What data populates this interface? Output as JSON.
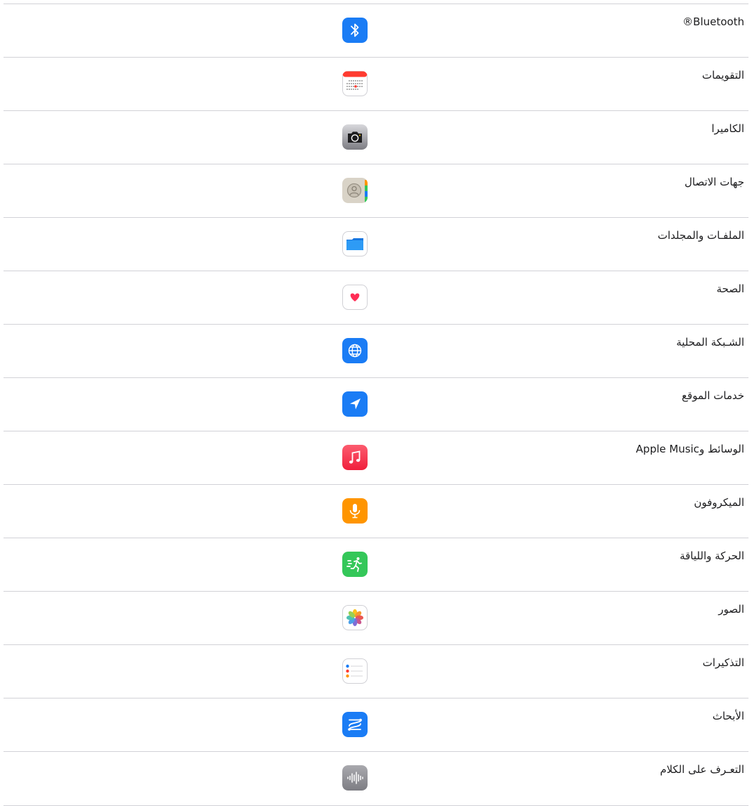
{
  "rows": [
    {
      "label": "Bluetooth®",
      "icon": "bluetooth-icon",
      "color": "#1a7cf5"
    },
    {
      "label": "التقويمات",
      "icon": "calendar-icon",
      "color": "#ff3b30"
    },
    {
      "label": "الكاميرا",
      "icon": "camera-icon",
      "color": "#8e8e93"
    },
    {
      "label": "جهات الاتصال",
      "icon": "contacts-icon",
      "color": "#d9d3c7"
    },
    {
      "label": "الملفـات والمجلدات",
      "icon": "files-icon",
      "color": "#1e8ff0"
    },
    {
      "label": "الصحة",
      "icon": "health-icon",
      "color": "#ff2d55"
    },
    {
      "label": "الشـبكة المحلية",
      "icon": "local-network-icon",
      "color": "#1a7cf5"
    },
    {
      "label": "خدمات الموقع",
      "icon": "location-services-icon",
      "color": "#1a7cf5"
    },
    {
      "label": "الوسائط وApple Music",
      "icon": "music-icon",
      "color": "#fa3c4c"
    },
    {
      "label": "الميكروفون",
      "icon": "microphone-icon",
      "color": "#ff9500"
    },
    {
      "label": "الحركة واللياقة",
      "icon": "motion-fitness-icon",
      "color": "#34c759"
    },
    {
      "label": "الصور",
      "icon": "photos-icon",
      "color": "#ffffff"
    },
    {
      "label": "التذكيرات",
      "icon": "reminders-icon",
      "color": "#ffffff"
    },
    {
      "label": "الأبحاث",
      "icon": "research-icon",
      "color": "#1a7cf5"
    },
    {
      "label": "التعـرف على الكلام",
      "icon": "speech-recognition-icon",
      "color": "#8e8e93"
    }
  ]
}
